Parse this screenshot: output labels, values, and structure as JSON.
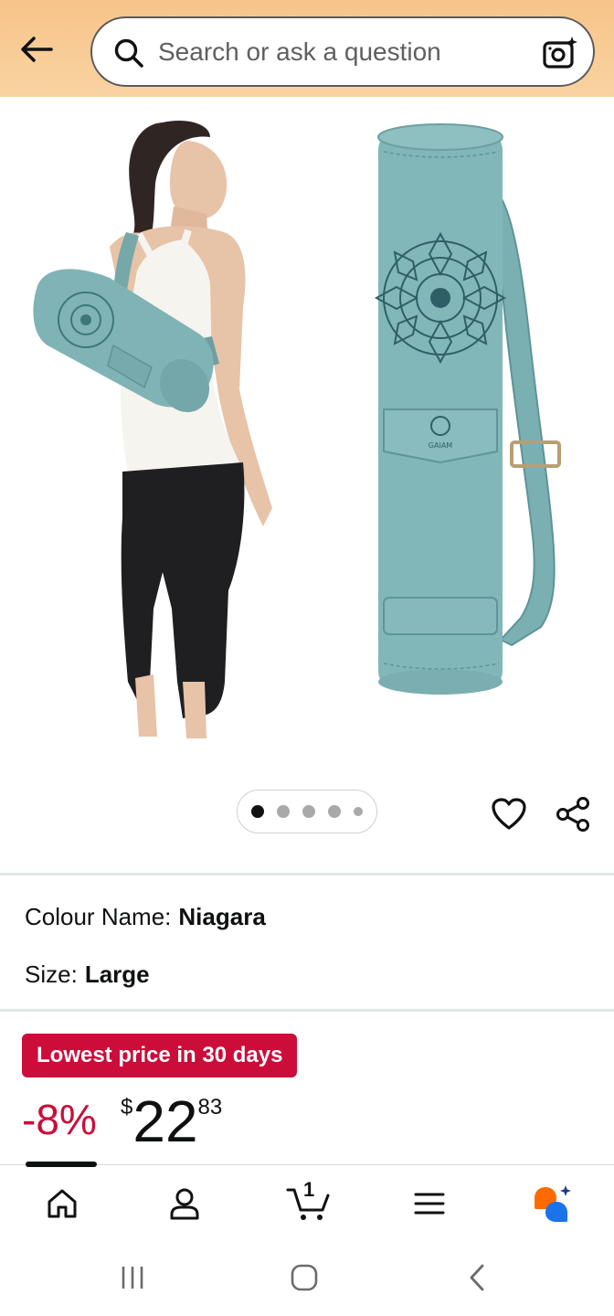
{
  "search": {
    "placeholder": "Search or ask a question"
  },
  "product": {
    "colour_label": "Colour Name:",
    "colour_value": "Niagara",
    "size_label": "Size:",
    "size_value": "Large",
    "badge": "Lowest price in 30 days",
    "discount": "-8%",
    "currency": "$",
    "price_whole": "22",
    "price_fraction": "83",
    "mat_bag_logo_text": "GAIAM"
  },
  "gallery": {
    "total_images": 5,
    "active_index": 0
  },
  "cart": {
    "count": "1"
  },
  "colors": {
    "accent": "#cc0c39",
    "header": "#f7c48a",
    "bag": "#7fb3b5"
  },
  "icons": {
    "back": "arrow-left-icon",
    "search": "search-icon",
    "camera": "camera-ai-icon",
    "heart": "heart-icon",
    "share": "share-icon",
    "home": "home-icon",
    "account": "user-icon",
    "cart": "cart-icon",
    "menu": "menu-icon",
    "assistant": "assistant-icon"
  }
}
